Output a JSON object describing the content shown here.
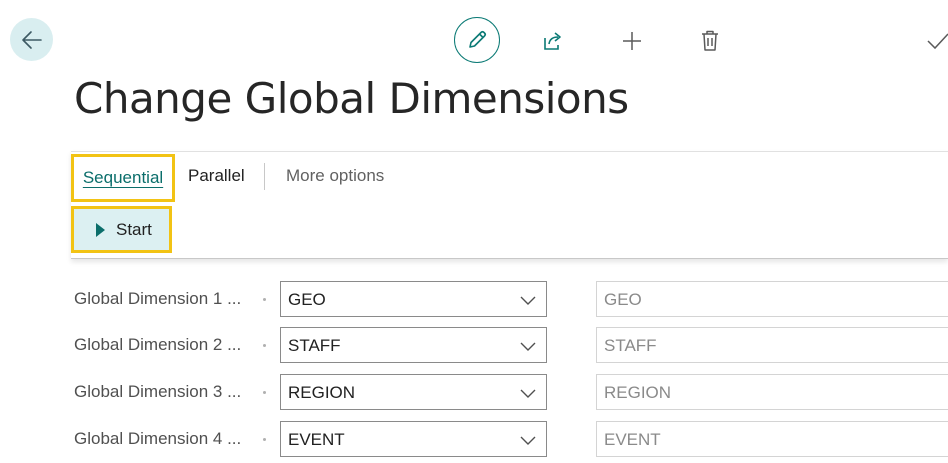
{
  "header": {
    "icons": [
      "back-arrow-icon",
      "pencil-icon",
      "share-icon",
      "plus-icon",
      "trash-icon",
      "check-icon"
    ]
  },
  "page": {
    "title": "Change Global Dimensions"
  },
  "action_bar": {
    "tabs": [
      {
        "label": "Sequential",
        "selected": true
      },
      {
        "label": "Parallel",
        "selected": false
      },
      {
        "label": "More options",
        "selected": false
      }
    ],
    "start_label": "Start"
  },
  "dimensions": [
    {
      "label": "Global Dimension 1 ...",
      "value": "GEO",
      "current": "GEO"
    },
    {
      "label": "Global Dimension 2 ...",
      "value": "STAFF",
      "current": "STAFF"
    },
    {
      "label": "Global Dimension 3 ...",
      "value": "REGION",
      "current": "REGION"
    },
    {
      "label": "Global Dimension 4 ...",
      "value": "EVENT",
      "current": "EVENT"
    }
  ],
  "colors": {
    "accent": "#0b6e6b",
    "highlight": "#f2c314",
    "back_button_bg": "#d9eef0"
  }
}
